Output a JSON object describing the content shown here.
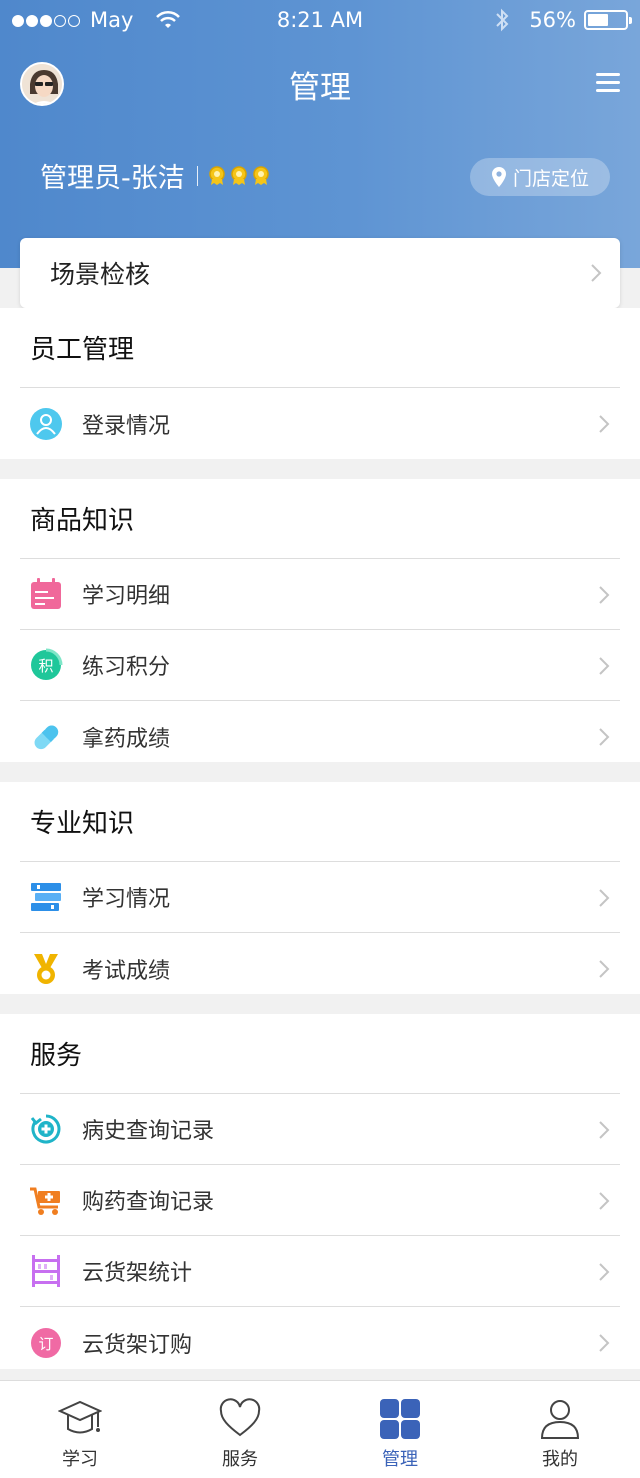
{
  "status": {
    "carrier": "May",
    "time": "8:21 AM",
    "battery": "56%"
  },
  "header": {
    "title": "管理",
    "admin_name": "管理员-张洁",
    "locate_label": "门店定位"
  },
  "scene": {
    "label": "场景检核"
  },
  "sections": [
    {
      "title": "员工管理",
      "items": [
        {
          "label": "登录情况",
          "icon": "user-icon"
        }
      ]
    },
    {
      "title": "商品知识",
      "items": [
        {
          "label": "学习明细",
          "icon": "calendar-icon"
        },
        {
          "label": "练习积分",
          "icon": "points-icon"
        },
        {
          "label": "拿药成绩",
          "icon": "pill-icon"
        }
      ]
    },
    {
      "title": "专业知识",
      "items": [
        {
          "label": "学习情况",
          "icon": "books-icon"
        },
        {
          "label": "考试成绩",
          "icon": "medal-icon"
        }
      ]
    },
    {
      "title": "服务",
      "items": [
        {
          "label": "病史查询记录",
          "icon": "medical-history-icon"
        },
        {
          "label": "购药查询记录",
          "icon": "cart-icon"
        },
        {
          "label": "云货架统计",
          "icon": "shelf-icon"
        },
        {
          "label": "云货架订购",
          "icon": "order-icon"
        }
      ]
    }
  ],
  "icon_texts": {
    "points": "积",
    "order": "订"
  },
  "tabs": [
    {
      "label": "学习",
      "icon": "graduation-cap-icon"
    },
    {
      "label": "服务",
      "icon": "heart-icon"
    },
    {
      "label": "管理",
      "icon": "grid-icon",
      "active": true
    },
    {
      "label": "我的",
      "icon": "person-icon"
    }
  ],
  "colors": {
    "header": "#5a91d2",
    "active_tab": "#3b63b8"
  }
}
